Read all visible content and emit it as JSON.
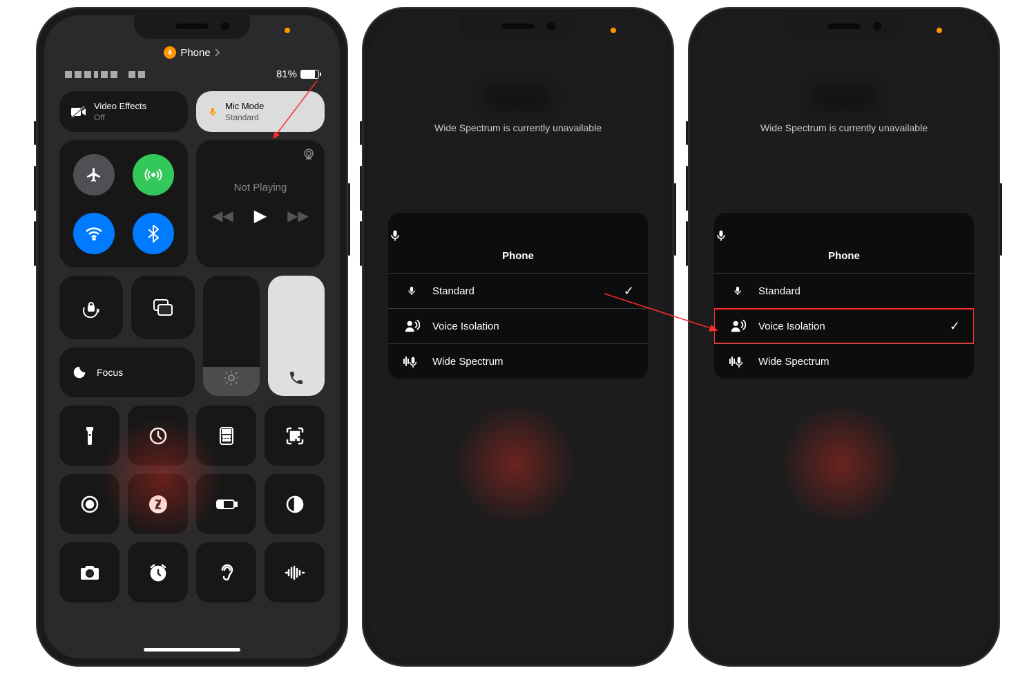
{
  "phone1": {
    "header_app": "Phone",
    "battery_pct": "81%",
    "video_effects": {
      "title": "Video Effects",
      "subtitle": "Off"
    },
    "mic_mode": {
      "title": "Mic Mode",
      "subtitle": "Standard"
    },
    "media": {
      "title": "Not Playing"
    },
    "focus": {
      "label": "Focus"
    }
  },
  "phone2": {
    "ws_msg": "Wide Spectrum is currently unavailable",
    "menu_title": "Phone",
    "rows": [
      {
        "label": "Standard",
        "checked": true
      },
      {
        "label": "Voice Isolation",
        "checked": false
      },
      {
        "label": "Wide Spectrum",
        "checked": false
      }
    ]
  },
  "phone3": {
    "ws_msg": "Wide Spectrum is currently unavailable",
    "menu_title": "Phone",
    "rows": [
      {
        "label": "Standard",
        "checked": false
      },
      {
        "label": "Voice Isolation",
        "checked": true
      },
      {
        "label": "Wide Spectrum",
        "checked": false
      }
    ]
  }
}
